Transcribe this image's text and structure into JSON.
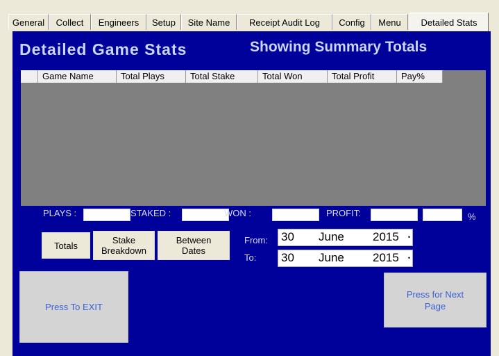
{
  "tabs": [
    {
      "label": "General"
    },
    {
      "label": "Collect"
    },
    {
      "label": "Engineers"
    },
    {
      "label": "Setup"
    },
    {
      "label": "Site Name"
    },
    {
      "label": "Receipt Audit Log"
    },
    {
      "label": "Config"
    },
    {
      "label": "Menu"
    },
    {
      "label": "Detailed Stats"
    }
  ],
  "header": {
    "title": "Detailed Game Stats",
    "subtitle": "Showing Summary Totals"
  },
  "grid": {
    "columns": [
      "",
      "Game Name",
      "Total Plays",
      "Total Stake",
      "Total Won",
      "Total Profit",
      "Pay%"
    ]
  },
  "summary": {
    "plays_label": "PLAYS :",
    "plays_value": "",
    "staked_label": "STAKED :",
    "staked_value": "",
    "won_label": "WON :",
    "won_value": "",
    "profit_label": "PROFIT:",
    "profit_value": "",
    "pay_value": "",
    "percent_label": "%"
  },
  "buttons": {
    "totals": "Totals",
    "stake_breakdown_1": "Stake",
    "stake_breakdown_2": "Breakdown",
    "between_dates_1": "Between",
    "between_dates_2": "Dates",
    "exit": "Press To EXIT",
    "next_page_1": "Press for Next",
    "next_page_2": "Page"
  },
  "dates": {
    "from_label": "From:",
    "to_label": "To:",
    "from": {
      "day": "30",
      "month": "June",
      "year": "2015"
    },
    "to": {
      "day": "30",
      "month": "June",
      "year": "2015"
    }
  },
  "icons": {
    "spin": "dropdown-spin-icon"
  },
  "colors": {
    "panel": "#00009a",
    "title": "#c9d6f2",
    "grid": "#808080"
  }
}
